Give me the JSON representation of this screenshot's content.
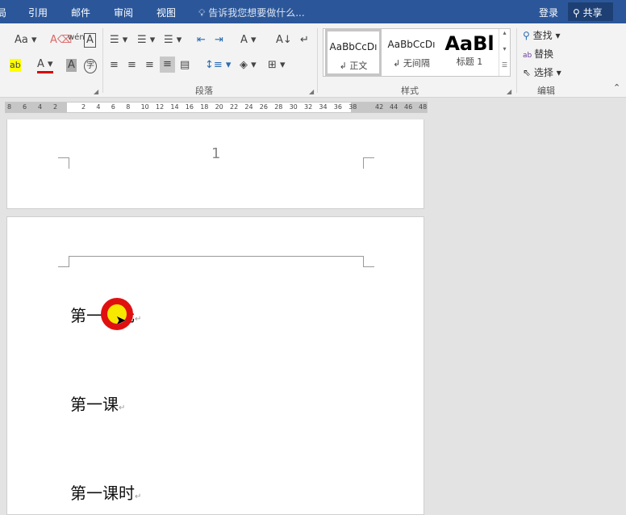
{
  "tabs": [
    "局",
    "引用",
    "邮件",
    "审阅",
    "视图"
  ],
  "tell_me": "告诉我您想要做什么...",
  "login": "登录",
  "share": "共享",
  "groups": {
    "paragraph": "段落",
    "styles": "样式",
    "editing": "编辑"
  },
  "styles": [
    {
      "preview": "AaBbCcDı",
      "name": "↲ 正文"
    },
    {
      "preview": "AaBbCcDı",
      "name": "↲ 无间隔"
    },
    {
      "preview": "AaBl",
      "name": "标题 1"
    }
  ],
  "editing": {
    "find": "查找",
    "replace": "替换",
    "select": "选择"
  },
  "ruler": {
    "left": [
      "8",
      "6",
      "4",
      "2"
    ],
    "main": [
      "2",
      "4",
      "6",
      "8",
      "10",
      "12",
      "14",
      "16",
      "18",
      "20",
      "22",
      "24",
      "26",
      "28",
      "30",
      "32",
      "34",
      "36",
      "38"
    ],
    "right": [
      "42",
      "44",
      "46",
      "48"
    ]
  },
  "page1": {
    "page_number": "1"
  },
  "page2": {
    "lines": [
      "第一单元",
      "第一课",
      "第一课时"
    ]
  },
  "colors": {
    "accent": "#2b579a"
  }
}
